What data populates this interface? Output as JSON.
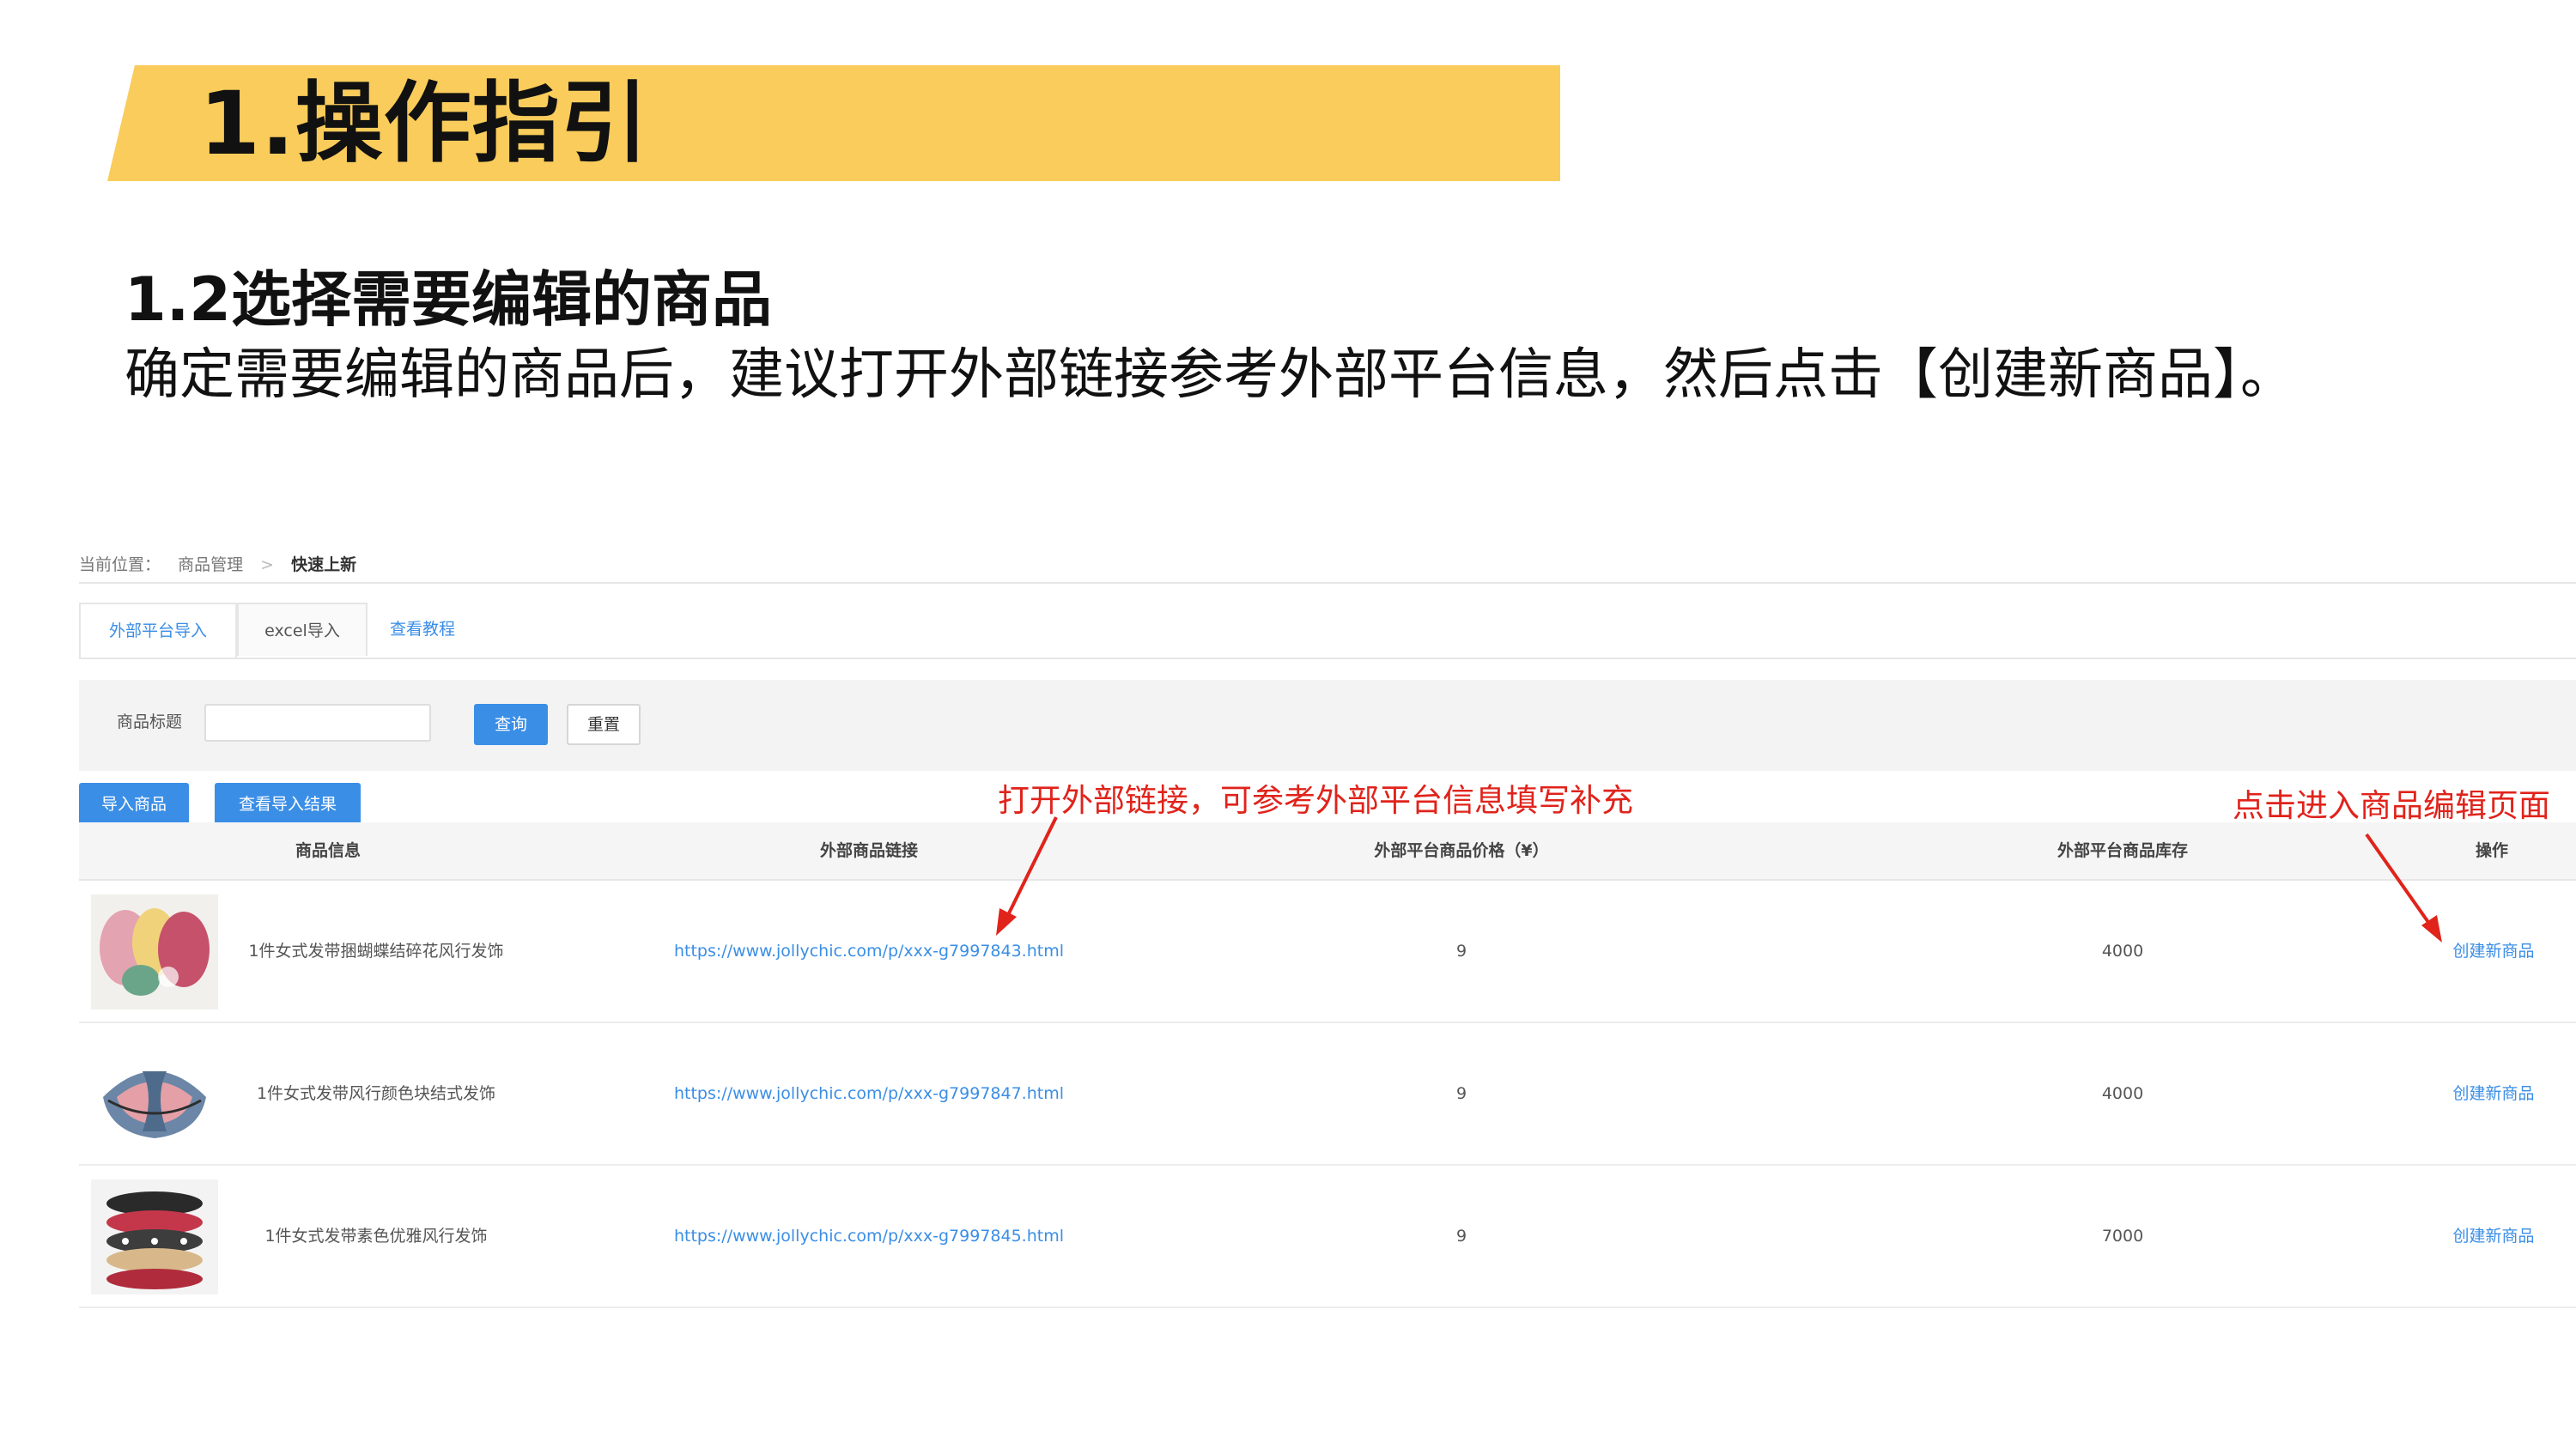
{
  "slide": {
    "title": "1.操作指引",
    "subtitle": "1.2选择需要编辑的商品",
    "description": "确定需要编辑的商品后，建议打开外部链接参考外部平台信息，然后点击【创建新商品】。"
  },
  "breadcrumb": {
    "label": "当前位置：",
    "items": [
      "商品管理",
      "快速上新"
    ],
    "separator": ">"
  },
  "tabs": [
    {
      "label": "外部平台导入",
      "active": true
    },
    {
      "label": "excel导入",
      "active": false
    }
  ],
  "tutorial_link": "查看教程",
  "filter": {
    "label": "商品标题",
    "input_value": "",
    "query_button": "查询",
    "reset_button": "重置"
  },
  "actions": {
    "import_button": "导入商品",
    "view_results_button": "查看导入结果"
  },
  "annotations": {
    "link_hint": "打开外部链接，可参考外部平台信息填写补充",
    "edit_hint": "点击进入商品编辑页面"
  },
  "table": {
    "columns": [
      "商品信息",
      "外部商品链接",
      "外部平台商品价格（¥）",
      "外部平台商品库存",
      "操作"
    ],
    "rows": [
      {
        "name": "1件女式发带捆蝴蝶结碎花风行发饰",
        "url": "https://www.jollychic.com/p/xxx-g7997843.html",
        "price": "9",
        "stock": "4000",
        "action": "创建新商品"
      },
      {
        "name": "1件女式发带风行颜色块结式发饰",
        "url": "https://www.jollychic.com/p/xxx-g7997847.html",
        "price": "9",
        "stock": "4000",
        "action": "创建新商品"
      },
      {
        "name": "1件女式发带素色优雅风行发饰",
        "url": "https://www.jollychic.com/p/xxx-g7997845.html",
        "price": "9",
        "stock": "7000",
        "action": "创建新商品"
      }
    ]
  },
  "colors": {
    "banner": "#f9cc5b",
    "primary": "#3a8ee6",
    "annotation": "#e0231b"
  }
}
